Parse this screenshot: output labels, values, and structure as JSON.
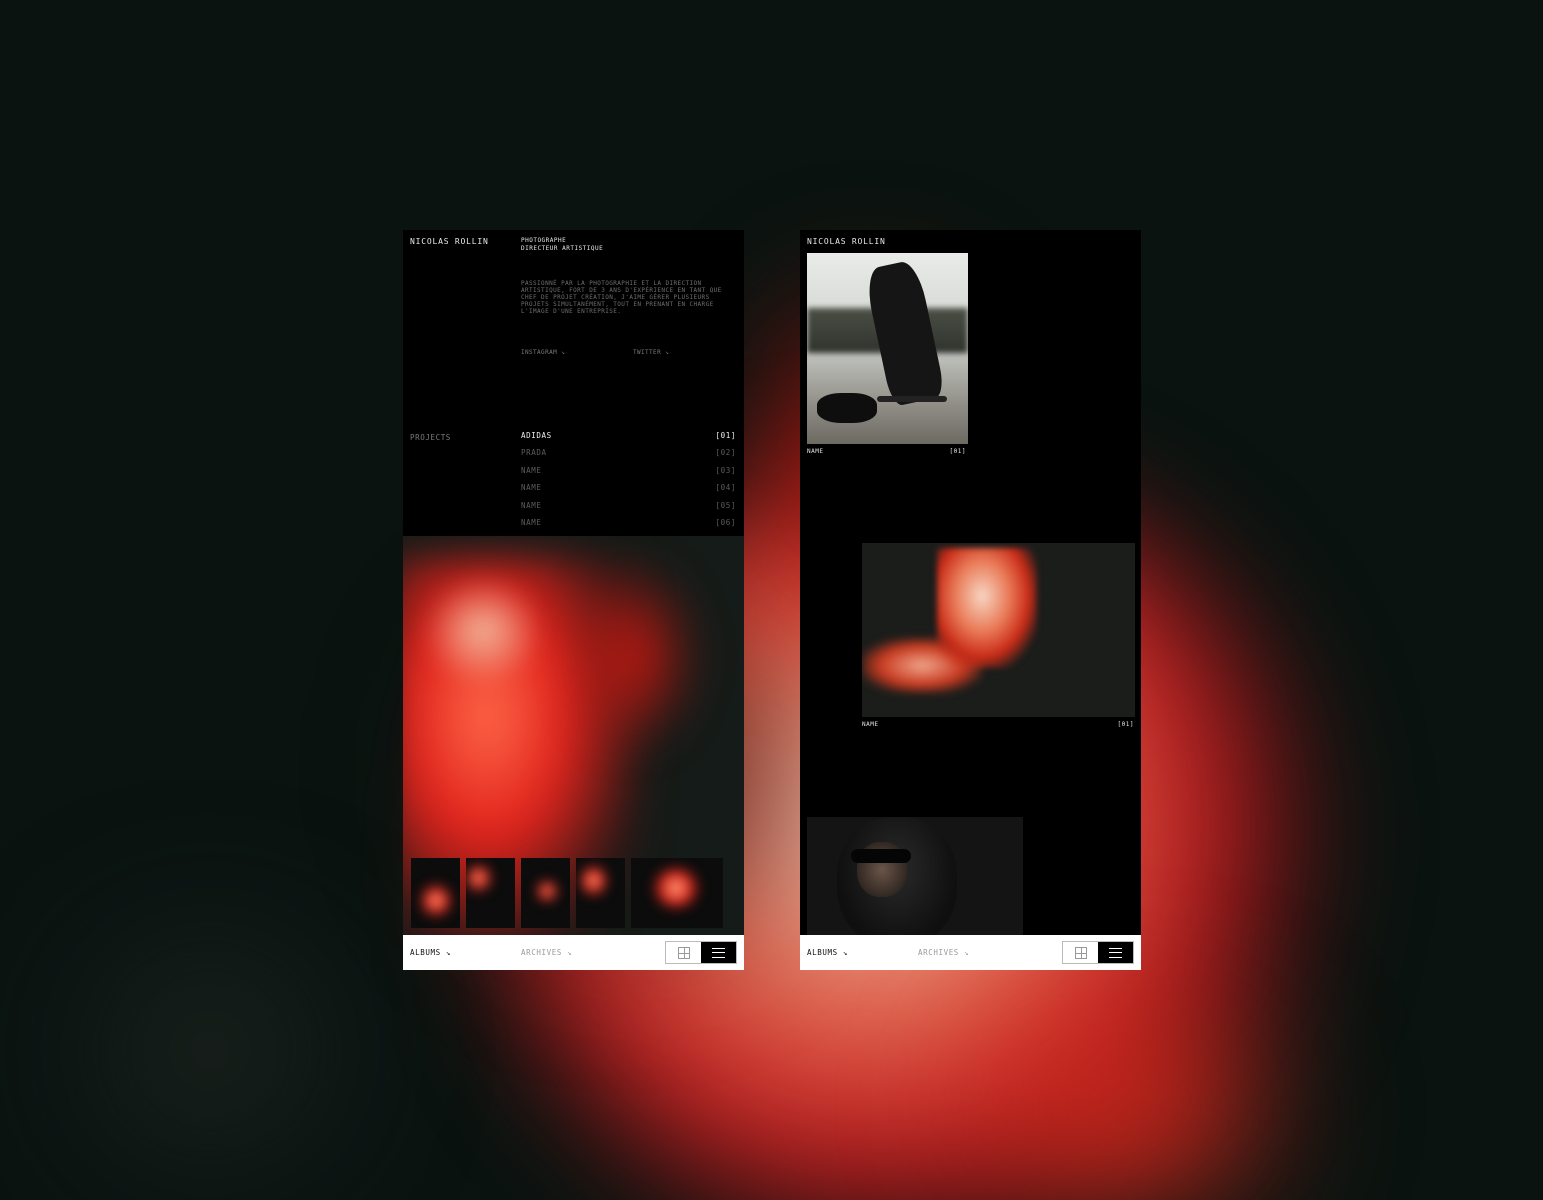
{
  "brand": "NICOLAS ROLLIN",
  "roles": [
    "PHOTOGRAPHE",
    "DIRECTEUR ARTISTIQUE"
  ],
  "bio": "PASSIONNÉ PAR LA PHOTOGRAPHIE ET LA DIRECTION ARTISTIQUE, FORT DE 3 ANS D'EXPÉRIENCE EN TANT QUE CHEF DE PROJET CRÉATION, J'AIME GÉRER PLUSIEURS PROJETS SIMULTANÉMENT, TOUT EN PRENANT EN CHARGE L'IMAGE D'UNE ENTREPRISE.",
  "social": {
    "instagram": "INSTAGRAM ↘",
    "twitter": "TWITTER ↘"
  },
  "projects": {
    "label": "PROJECTS",
    "items": [
      {
        "name": "ADIDAS",
        "num": "[01]"
      },
      {
        "name": "PRADA",
        "num": "[02]"
      },
      {
        "name": "NAME",
        "num": "[03]"
      },
      {
        "name": "NAME",
        "num": "[04]"
      },
      {
        "name": "NAME",
        "num": "[05]"
      },
      {
        "name": "NAME",
        "num": "[06]"
      }
    ]
  },
  "bottom_bar": {
    "albums": "ALBUMS ↘",
    "archives": "ARCHIVES ↘"
  },
  "gallery": [
    {
      "name": "NAME",
      "num": "[01]"
    },
    {
      "name": "NAME",
      "num": "[01]"
    }
  ],
  "colors": {
    "accent_red": "#e1231c",
    "background": "#0a1310",
    "panel": "#000000",
    "bar": "#ffffff"
  }
}
